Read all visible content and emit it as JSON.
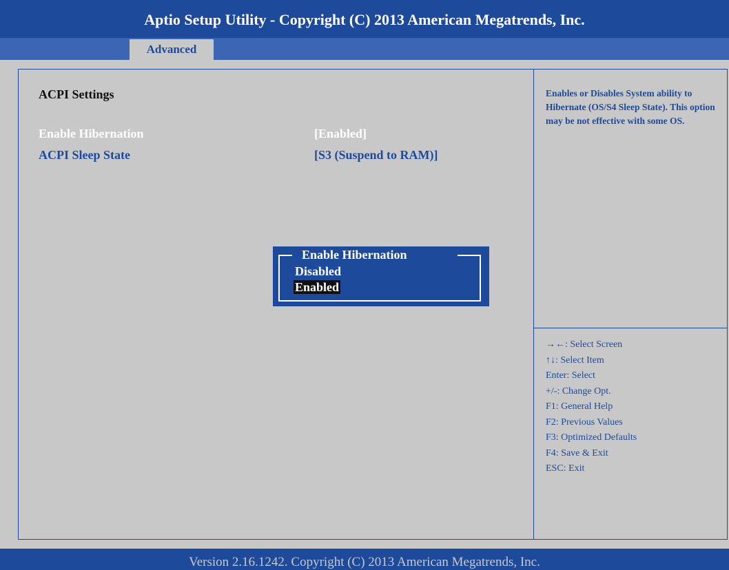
{
  "app_title": "Aptio Setup Utility - Copyright (C) 2013 American Megatrends, Inc.",
  "tabs": [
    {
      "label": "Advanced",
      "active": true
    }
  ],
  "section_title": "ACPI Settings",
  "settings": [
    {
      "label": "Enable Hibernation",
      "value": "[Enabled]",
      "selected": true
    },
    {
      "label": "ACPI Sleep State",
      "value": "[S3 (Suspend to RAM)]",
      "selected": false
    }
  ],
  "help_text": "Enables or Disables System ability to Hibernate (OS/S4 Sleep State). This option may be not effective with some OS.",
  "key_help": [
    "→←: Select Screen",
    "↑↓: Select Item",
    "Enter: Select",
    "+/-: Change Opt.",
    "F1: General Help",
    "F2: Previous Values",
    "F3: Optimized Defaults",
    "F4: Save & Exit",
    "ESC: Exit"
  ],
  "popup": {
    "title": "Enable Hibernation",
    "options": [
      {
        "label": "Disabled",
        "highlighted": false
      },
      {
        "label": "Enabled",
        "highlighted": true
      }
    ]
  },
  "footer": "Version 2.16.1242. Copyright (C) 2013 American Megatrends, Inc.",
  "colors": {
    "bios_blue": "#1e4a9c",
    "tab_strip_blue": "#3c66b4",
    "background_gray": "#c8c8c8",
    "highlight_black": "#111111",
    "text_white": "#ffffff"
  }
}
